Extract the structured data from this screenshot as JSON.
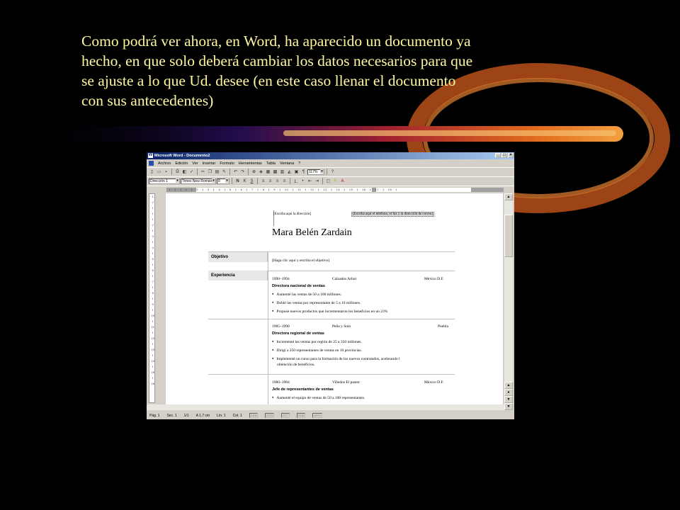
{
  "caption": {
    "line1": "Como podrá ver ahora, en Word, ha aparecido un documento ya",
    "line2": "hecho, en que solo deberá cambiar los datos necesarios para que",
    "line3": "se ajuste a lo que Ud. desee (en este caso llenar el documento",
    "line4": "con sus antecedentes)"
  },
  "colors": {
    "background": "#000000",
    "caption_text": "#fff7a0",
    "streak": "#d4601a",
    "titlebar": "#0a246a"
  },
  "window": {
    "title": "Microsoft Word - Documento2",
    "menu": [
      "Archivo",
      "Edición",
      "Ver",
      "Insertar",
      "Formato",
      "Herramientas",
      "Tabla",
      "Ventana",
      "?"
    ],
    "toolbar": {
      "zoom": "117%"
    },
    "format_bar": {
      "style": "Dirección 1",
      "font": "Times New Roman",
      "size": "8"
    }
  },
  "document": {
    "address_prompt": "[Escriba aquí la dirección]",
    "phone_prompt": "[Escriba aquí el teléfono, el fax y la dirección de correo]",
    "name": "Mara Belén Zardain",
    "sections": {
      "objective_label": "Objetivo",
      "objective_text": "[Haga clic aquí y escriba el objetivo]",
      "experience_label": "Experiencia"
    },
    "jobs": [
      {
        "dates": "1990–1994",
        "company": "Calzados Arbor",
        "city": "México D.F.",
        "title": "Directora nacional de ventas",
        "bullets": [
          "Aumenté las ventas de 50 a 100 millones.",
          "Doblé las ventas por representante de 5 a 10 millones.",
          "Propuse nuevos productos que incrementaron los beneficios en un 23%"
        ]
      },
      {
        "dates": "1985–1990",
        "company": "Peña y Soto",
        "city": "Puebla",
        "title": "Directora regional de ventas",
        "bullets": [
          "Incrementé las ventas por región de 25 a 350 millones.",
          "Dirigí a 250 representantes de ventas en 10 provincias.",
          "Implementé un curso para la formación de los nuevos contratados, acelerando l",
          "obtención de beneficios."
        ]
      },
      {
        "dates": "1980–1984",
        "company": "Viñedos El pastor",
        "city": "México D.F.",
        "title": "Jefe de representantes de ventas",
        "bullets": [
          "Aumenté el equipo de ventas de 50 a 100 representantes."
        ]
      }
    ]
  },
  "status": {
    "page": "Pág. 1",
    "section": "Sec. 1",
    "pages": "1/1",
    "position": "A 1,7 cm",
    "line": "Lín. 1",
    "col": "Col. 1",
    "indicators": [
      "GRB",
      "MCA",
      "EXT",
      "SOB",
      "WPH"
    ]
  }
}
